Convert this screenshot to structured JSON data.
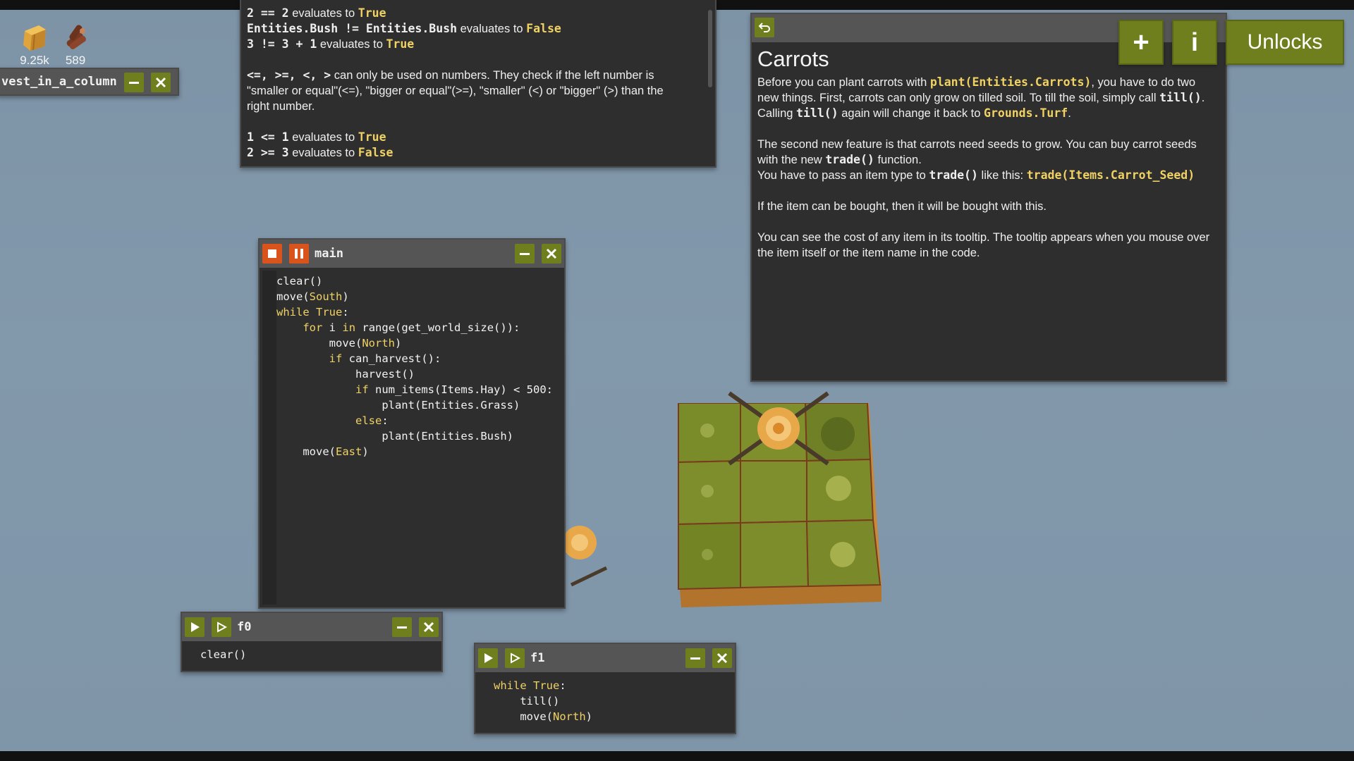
{
  "resources": {
    "hay": "9.25k",
    "wood": "589"
  },
  "colors": {
    "accent": "#6f7f1e",
    "orange": "#d9531c",
    "keyword": "#f0d264",
    "panel": "#2e2e2e"
  },
  "harvest_window": {
    "title": "vest_in_a_column"
  },
  "docs_top": {
    "lines": [
      {
        "a": "2 == 2",
        "b": " evaluates to ",
        "c": "True"
      },
      {
        "a": "Entities.Bush != Entities.Bush",
        "b": " evaluates to ",
        "c": "False"
      },
      {
        "a": "3 != 3 + 1",
        "b": " evaluates to ",
        "c": "True"
      }
    ],
    "ops": "<=, >=, <, >",
    "ops_text1": " can only be used on numbers. They check if the left number is",
    "ops_text2": "\"smaller or equal\"(<=), \"bigger or equal\"(>=), \"smaller\" (<) or \"bigger\" (>) than the",
    "ops_text3": "right number.",
    "lines2": [
      {
        "a": "1 <= 1",
        "b": " evaluates to ",
        "c": "True"
      },
      {
        "a": "2 >= 3",
        "b": " evaluates to ",
        "c": "False"
      }
    ]
  },
  "main_window": {
    "title": "main",
    "code": [
      "clear()",
      "move(South)",
      "while True:",
      "    for i in range(get_world_size()):",
      "        move(North)",
      "        if can_harvest():",
      "            harvest()",
      "            if num_items(Items.Hay) < 500:",
      "                plant(Entities.Grass)",
      "            else:",
      "                plant(Entities.Bush)",
      "    move(East)"
    ]
  },
  "f0_window": {
    "title": "f0",
    "code": [
      "clear()"
    ]
  },
  "f1_window": {
    "title": "f1",
    "code": [
      "while True:",
      "    till()",
      "    move(North)"
    ]
  },
  "carrots_doc": {
    "title": "Carrots",
    "p1_a": "Before you can plant carrots with ",
    "p1_code1": "plant(Entities.Carrots)",
    "p1_b": ", you have to do two new things. First, carrots can only grow on tilled soil. To till the soil, simply call ",
    "p1_code2": "till()",
    "p1_c": ". Calling ",
    "p1_code3": "till()",
    "p1_d": " again will change it back to ",
    "p1_code4": "Grounds.Turf",
    "p1_e": ".",
    "p2_a": "The second new feature is that carrots need seeds to grow. You can buy carrot seeds with the new ",
    "p2_code1": "trade()",
    "p2_b": " function.",
    "p3_a": "You have to pass an item type to ",
    "p3_code1": "trade()",
    "p3_b": " like this: ",
    "p3_code2": "trade(Items.Carrot_Seed)",
    "p4": "If the item can be bought, then it will be bought with this.",
    "p5": "You can see the cost of any item in its tooltip. The tooltip appears when you mouse over the item itself or the item name in the code."
  },
  "top_buttons": {
    "plus": "+",
    "info": "i",
    "unlocks": "Unlocks"
  }
}
